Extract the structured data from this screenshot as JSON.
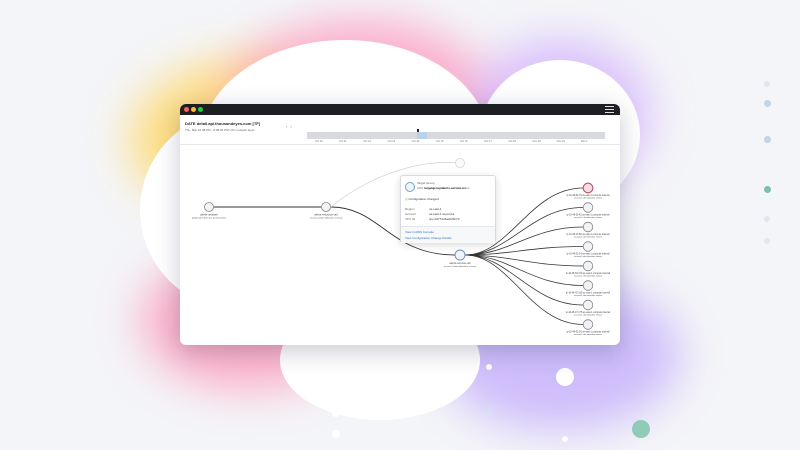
{
  "window": {
    "service_name": "DATE detail.api.thousandeyes.com [TF]",
    "service_time": "Thu, Mar 16 08 PM - 8:38:00 PM UTC network layer",
    "nav_prev": "‹",
    "nav_next": "›",
    "timeline_ticks": [
      "Oct 10",
      "Oct 11",
      "Oct 12",
      "Oct 13",
      "Oct 14",
      "Oct 15",
      "Oct 16",
      "Oct 17",
      "Oct 18",
      "Nov 20",
      "Nov 21",
      "Dec 1"
    ]
  },
  "graph": {
    "left_nodes": [
      {
        "title": "alerts-network",
        "sub": "global alert detection (connections)"
      },
      {
        "title": "alerts-resource-util",
        "sub": "us-east-1 (alert detection service)"
      }
    ],
    "center_node": {
      "title": "alerts-service-util",
      "sub": "us-east-1 (alert detection service)"
    },
    "right_nodes": [
      {
        "title": "ip-10-48-52-79.us-east-1.compute.internal",
        "sub": "us-east-1 alert detection service"
      },
      {
        "title": "ip-10-48-53-42.us-east-1.compute.internal",
        "sub": "us-east-1 alert detection service"
      },
      {
        "title": "ip-10-48-17-86.us-east-1.compute.internal",
        "sub": "us-east-1 alert detection service"
      },
      {
        "title": "ip-10-48-51-24.us-east-1.compute.internal",
        "sub": "us-east-1 alert detection service"
      },
      {
        "title": "ip-10-48-53-170.us-east-1.compute.internal",
        "sub": "us-east-1 alert detection service"
      },
      {
        "title": "ip-10-48-42-136.us-east-1.compute.internal",
        "sub": "us-east-1 alert detection service"
      },
      {
        "title": "ip-10-48-17-175.us-east-1.compute.internal",
        "sub": "us-east-1 alert detection service"
      },
      {
        "title": "ip-10-48-62-26.us-east-1.compute.internal",
        "sub": "us-east-1 alert detection service"
      }
    ]
  },
  "popup": {
    "type_label": "Target Group",
    "arn_label": "ARN",
    "arn_value": "targetgroup/alerts-service-tcs",
    "status": "Configuration changed",
    "rows": [
      {
        "k": "Region",
        "v": "us-east-1"
      },
      {
        "k": "Account",
        "v": "us-east-1 al-prod-a"
      },
      {
        "k": "VPC ID",
        "v": "vpc-0d772e6a2c05c70"
      }
    ],
    "link_console": "View in AWS Console",
    "link_changes": "View Configuration Change Details"
  },
  "colors": {
    "accent_blue": "#2f6fd1",
    "status_green": "#3aa85a",
    "alert_red": "#c0506a"
  }
}
